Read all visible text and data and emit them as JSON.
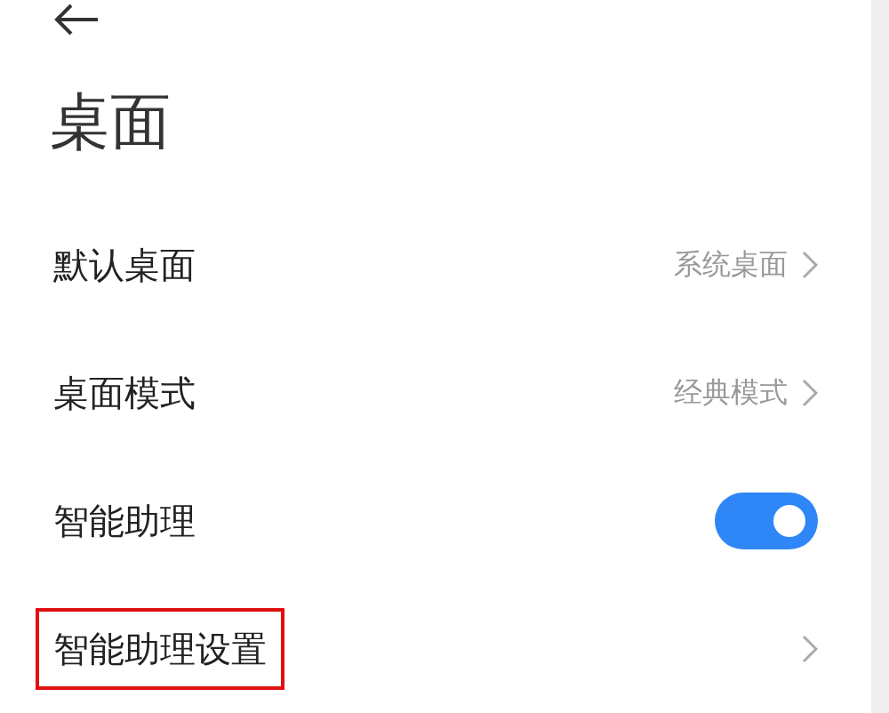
{
  "title": "桌面",
  "items": [
    {
      "kind": "link",
      "label": "默认桌面",
      "value": "系统桌面",
      "highlighted": false
    },
    {
      "kind": "link",
      "label": "桌面模式",
      "value": "经典模式",
      "highlighted": false
    },
    {
      "kind": "toggle",
      "label": "智能助理",
      "on": true,
      "highlighted": false
    },
    {
      "kind": "link",
      "label": "智能助理设置",
      "highlighted": true
    }
  ]
}
